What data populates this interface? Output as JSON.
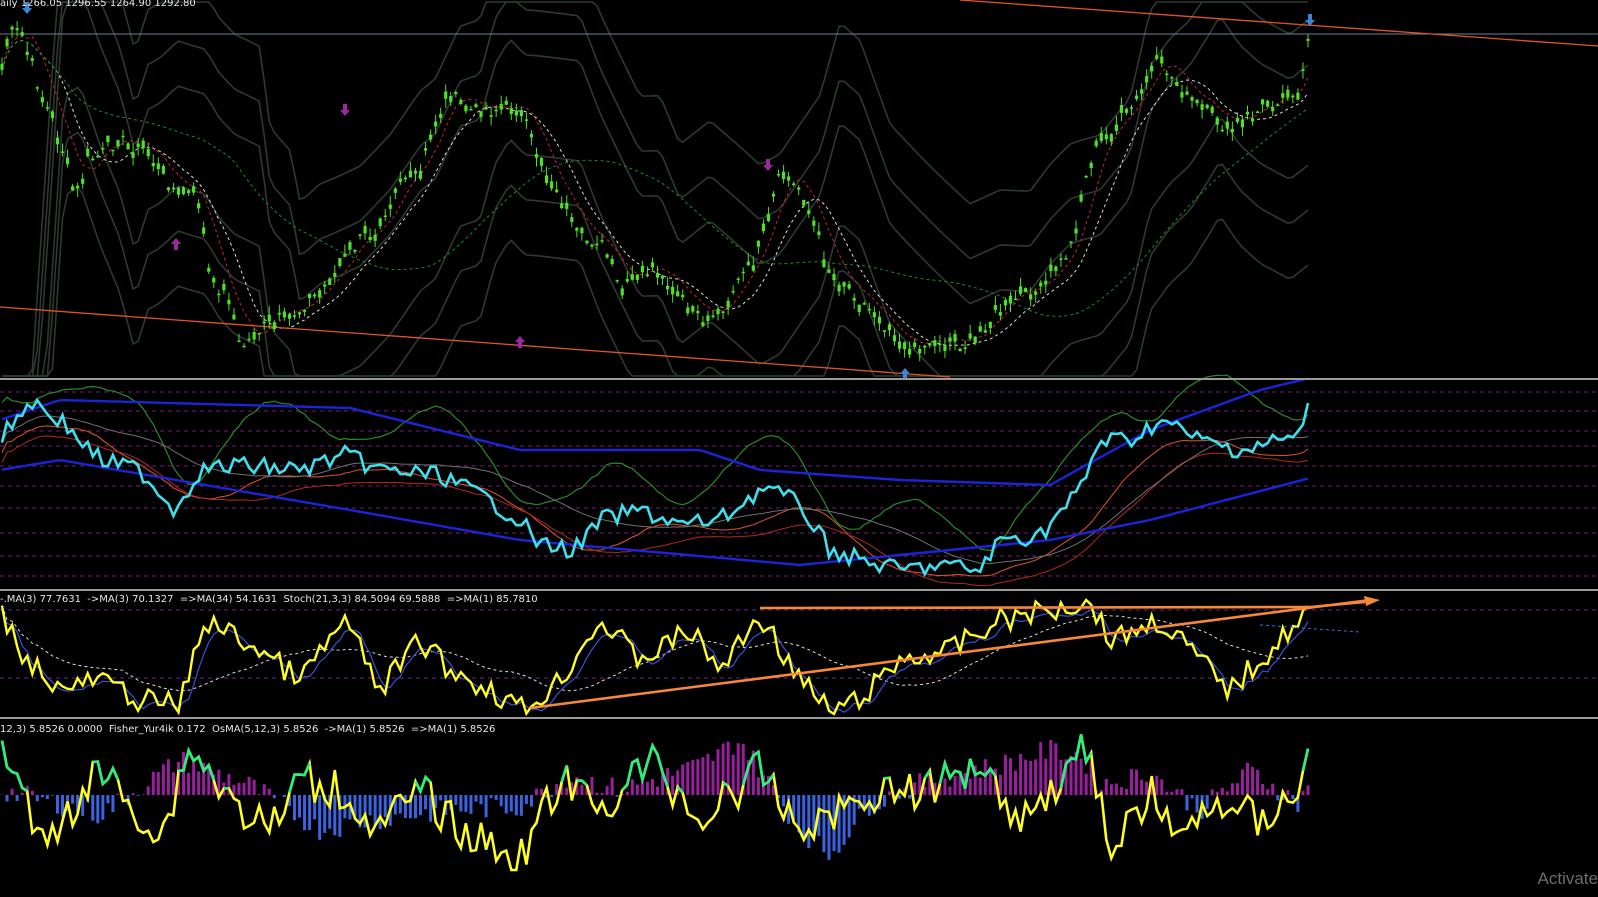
{
  "price_header": "aily 1266.05 1296.55 1264.90 1292.80",
  "stoch_header": "-.MA(3) 77.7631  ->MA(3) 70.1327  =>MA(34) 54.1631  Stoch(21,3,3) 84.5094 69.5888  =>MA(1) 85.7810",
  "osc_header": "12,3) 5.8526 0.0000  Fisher_Yur4ik 0.172  OsMA(5,12,3) 5.8526  ->MA(1) 5.8526  =>MA(1) 5.8526",
  "watermark": "Activate",
  "colors": {
    "candle": "#4fe028",
    "trendline": "#e0542a",
    "arrow_up": "#3a86d6",
    "arrow_down": "#9b2aa0",
    "hline": "#6f7f94",
    "rsi_main": "#3ee0ee",
    "band_blue": "#1c24d8",
    "stoch_main": "#ffff22",
    "stoch_trend": "#f5883a",
    "fisher": "#ffff22",
    "fisher_pos": "#28f080",
    "osma_pos": "#9a1f9e",
    "osma_neg": "#3a63e0"
  },
  "chart_data": [
    {
      "type": "candlestick",
      "panel": "price",
      "open": 1266.05,
      "high": 1296.55,
      "low": 1264.9,
      "close": 1292.8,
      "indicators": [
        "Bollinger/envelope bands",
        "red MA",
        "white dashed MA",
        "green dashed MA",
        "fractal arrows",
        "trendlines"
      ]
    },
    {
      "type": "line",
      "panel": "rsi_bands",
      "levels_dashed": 6
    },
    {
      "type": "line",
      "panel": "stochastic",
      "series": [
        {
          "name": "Stoch(21,3,3)",
          "values": [
            84.5094,
            69.5888
          ]
        },
        {
          "name": "-.MA(3)",
          "values": [
            77.7631
          ]
        },
        {
          "name": "->MA(3)",
          "values": [
            70.1327
          ]
        },
        {
          "name": "=>MA(34)",
          "values": [
            54.1631
          ]
        },
        {
          "name": "=>MA(1)",
          "values": [
            85.781
          ]
        }
      ]
    },
    {
      "type": "bar",
      "panel": "osma_fisher",
      "series": [
        {
          "name": "Fisher_Yur4ik",
          "values": [
            0.172
          ]
        },
        {
          "name": "OsMA(5,12,3)",
          "values": [
            5.8526
          ]
        },
        {
          "name": "->MA(1)",
          "values": [
            5.8526
          ]
        },
        {
          "name": "=>MA(1)",
          "values": [
            5.8526
          ]
        }
      ]
    }
  ]
}
